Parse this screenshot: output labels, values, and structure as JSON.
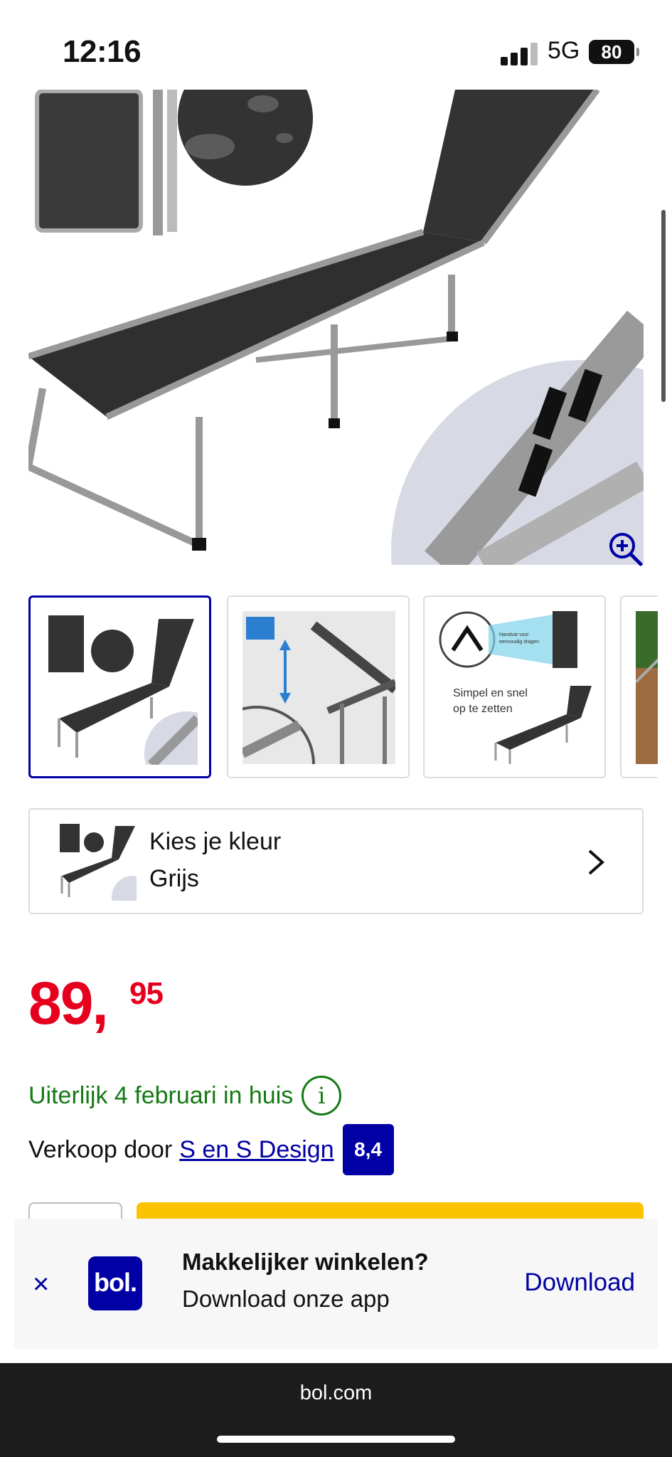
{
  "status_bar": {
    "time": "12:16",
    "network": "5G",
    "battery": "80"
  },
  "product": {
    "image_alt_icon": "zoom-in-icon",
    "thumbnails": [
      {
        "label": "",
        "selected": true
      },
      {
        "label": "",
        "selected": false
      },
      {
        "label": "Simpel en snel op te zetten",
        "selected": false
      },
      {
        "label": "",
        "selected": false
      }
    ],
    "thumb3_line1": "Simpel en snel",
    "thumb3_line2": "op te zetten",
    "thumb3_callout": "Handvat voor eenvoudig dragen"
  },
  "color_select": {
    "label": "Kies je kleur",
    "value": "Grijs"
  },
  "price": {
    "whole": "89,",
    "cents": "95"
  },
  "delivery": {
    "text": "Uiterlijk 4 februari in huis",
    "info_icon": "i"
  },
  "seller": {
    "prefix": "Verkoop door",
    "name": "S en S Design",
    "score": "8,4"
  },
  "app_banner": {
    "close": "×",
    "logo": "bol.",
    "title": "Makkelijker winkelen?",
    "subtitle": "Download onze app",
    "cta": "Download"
  },
  "browser": {
    "url": "bol.com"
  },
  "colors": {
    "brand_blue": "#0000a4",
    "price_red": "#e6001e",
    "delivery_green": "#147a14",
    "cart_yellow": "#fcc400"
  }
}
